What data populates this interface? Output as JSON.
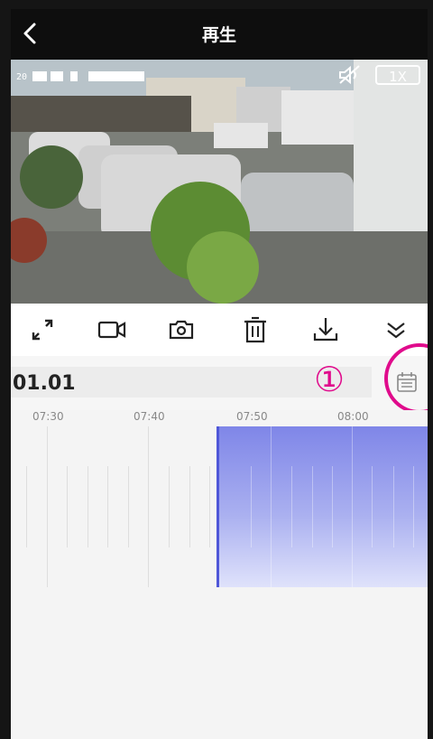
{
  "header": {
    "title": "再生"
  },
  "video": {
    "timestamp_prefix": "20",
    "speed_label": "1X"
  },
  "toolbar": {
    "items": [
      {
        "name": "fullscreen-icon"
      },
      {
        "name": "record-video-icon"
      },
      {
        "name": "snapshot-camera-icon"
      },
      {
        "name": "delete-trash-icon"
      },
      {
        "name": "download-icon"
      },
      {
        "name": "collapse-chevrons-icon"
      }
    ]
  },
  "date": {
    "label": "01.01",
    "annotation": "①"
  },
  "timeline": {
    "ticks": [
      "07:30",
      "07:40",
      "07:50",
      "08:00"
    ]
  },
  "colors": {
    "annotation": "#e00b8c",
    "recording": "#7f86e8",
    "header_bg": "#0e0e0e"
  }
}
